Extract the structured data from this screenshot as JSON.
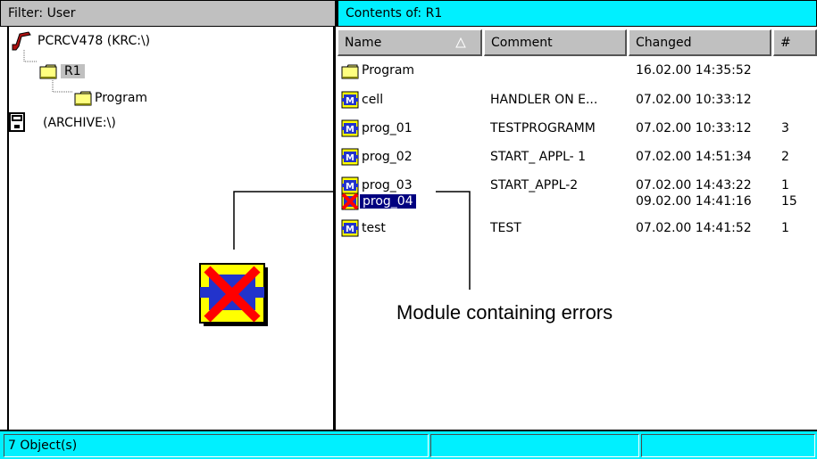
{
  "left_header": {
    "title": "Filter: User"
  },
  "right_header": {
    "title": "Contents of: R1"
  },
  "tree": {
    "root_label": "PCRCV478 (KRC:\\)",
    "r1_label": "R1",
    "program_label": "Program",
    "archive_label": "(ARCHIVE:\\)"
  },
  "columns": {
    "name": "Name",
    "comment": "Comment",
    "changed": "Changed",
    "num": "#"
  },
  "files": [
    {
      "name": "Program",
      "comment": "",
      "changed": "16.02.00 14:35:52",
      "num": "",
      "icon": "folder-icon"
    },
    {
      "name": "cell",
      "comment": "HANDLER ON E...",
      "changed": "07.02.00 10:33:12",
      "num": "",
      "icon": "module-icon"
    },
    {
      "name": "prog_01",
      "comment": "TESTPROGRAMM",
      "changed": "07.02.00 10:33:12",
      "num": "3",
      "icon": "module-icon"
    },
    {
      "name": "prog_02",
      "comment": "START_ APPL- 1",
      "changed": "07.02.00 14:51:34",
      "num": "2",
      "icon": "module-icon"
    },
    {
      "name": "prog_03",
      "comment": "START_APPL-2",
      "changed": "07.02.00 14:43:22",
      "num": "1",
      "icon": "module-icon"
    },
    {
      "name": "prog_04",
      "comment": "",
      "changed": "09.02.00 14:41:16",
      "num": "15",
      "icon": "module-error-icon",
      "selected": true
    },
    {
      "name": "test",
      "comment": "TEST",
      "changed": "07.02.00 14:41:52",
      "num": "1",
      "icon": "module-icon"
    }
  ],
  "callout": {
    "label": "Module containing errors"
  },
  "status_bar": {
    "object_count": "7 Object(s)",
    "segment_2": "",
    "segment_3": ""
  },
  "colors": {
    "header_cyan": "#00f0ff",
    "header_gray": "#c0c0c0",
    "selection": "#000080",
    "module_blue": "#2233cc",
    "module_yellow": "#ffff00",
    "error_red": "#ff0000"
  }
}
